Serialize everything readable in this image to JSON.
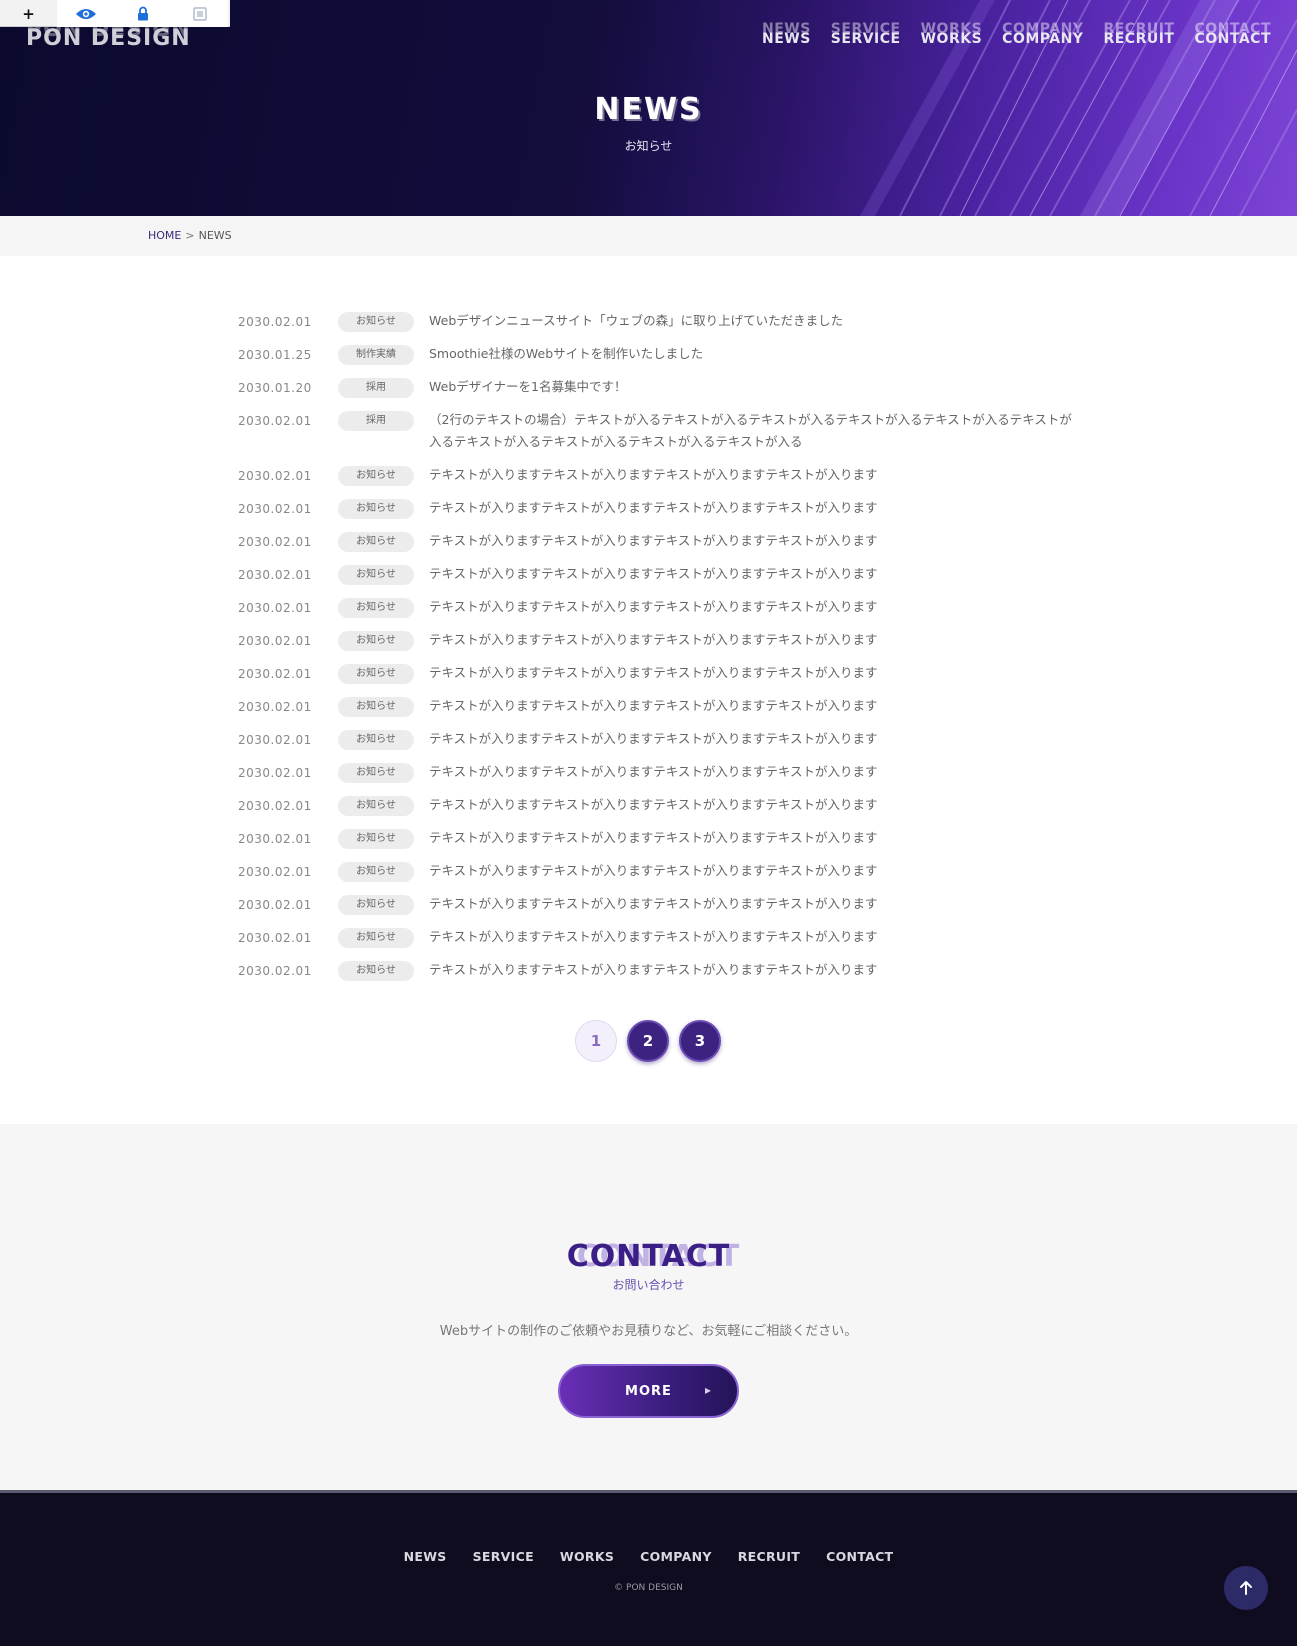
{
  "toolbar": {
    "add_label": "+",
    "icons": [
      "eye-icon",
      "lock-icon",
      "layout-icon"
    ]
  },
  "header": {
    "logo": "PON DESIGN",
    "nav": [
      "NEWS",
      "SERVICE",
      "WORKS",
      "COMPANY",
      "RECRUIT",
      "CONTACT"
    ],
    "title": "NEWS",
    "subtitle": "お知らせ"
  },
  "breadcrumb": {
    "home": "HOME",
    "separator": ">",
    "current": "NEWS"
  },
  "news": [
    {
      "date": "2030.02.01",
      "category": "お知らせ",
      "text": "Webデザインニュースサイト「ウェブの森」に取り上げていただきました"
    },
    {
      "date": "2030.01.25",
      "category": "制作実績",
      "text": "Smoothie社様のWebサイトを制作いたしました"
    },
    {
      "date": "2030.01.20",
      "category": "採用",
      "text": "Webデザイナーを1名募集中です！"
    },
    {
      "date": "2030.02.01",
      "category": "採用",
      "text": "（2行のテキストの場合）テキストが入るテキストが入るテキストが入るテキストが入るテキストが入るテキストが入るテキストが入るテキストが入るテキストが入るテキストが入る"
    },
    {
      "date": "2030.02.01",
      "category": "お知らせ",
      "text": "テキストが入りますテキストが入りますテキストが入りますテキストが入ります"
    },
    {
      "date": "2030.02.01",
      "category": "お知らせ",
      "text": "テキストが入りますテキストが入りますテキストが入りますテキストが入ります"
    },
    {
      "date": "2030.02.01",
      "category": "お知らせ",
      "text": "テキストが入りますテキストが入りますテキストが入りますテキストが入ります"
    },
    {
      "date": "2030.02.01",
      "category": "お知らせ",
      "text": "テキストが入りますテキストが入りますテキストが入りますテキストが入ります"
    },
    {
      "date": "2030.02.01",
      "category": "お知らせ",
      "text": "テキストが入りますテキストが入りますテキストが入りますテキストが入ります"
    },
    {
      "date": "2030.02.01",
      "category": "お知らせ",
      "text": "テキストが入りますテキストが入りますテキストが入りますテキストが入ります"
    },
    {
      "date": "2030.02.01",
      "category": "お知らせ",
      "text": "テキストが入りますテキストが入りますテキストが入りますテキストが入ります"
    },
    {
      "date": "2030.02.01",
      "category": "お知らせ",
      "text": "テキストが入りますテキストが入りますテキストが入りますテキストが入ります"
    },
    {
      "date": "2030.02.01",
      "category": "お知らせ",
      "text": "テキストが入りますテキストが入りますテキストが入りますテキストが入ります"
    },
    {
      "date": "2030.02.01",
      "category": "お知らせ",
      "text": "テキストが入りますテキストが入りますテキストが入りますテキストが入ります"
    },
    {
      "date": "2030.02.01",
      "category": "お知らせ",
      "text": "テキストが入りますテキストが入りますテキストが入りますテキストが入ります"
    },
    {
      "date": "2030.02.01",
      "category": "お知らせ",
      "text": "テキストが入りますテキストが入りますテキストが入りますテキストが入ります"
    },
    {
      "date": "2030.02.01",
      "category": "お知らせ",
      "text": "テキストが入りますテキストが入りますテキストが入りますテキストが入ります"
    },
    {
      "date": "2030.02.01",
      "category": "お知らせ",
      "text": "テキストが入りますテキストが入りますテキストが入りますテキストが入ります"
    },
    {
      "date": "2030.02.01",
      "category": "お知らせ",
      "text": "テキストが入りますテキストが入りますテキストが入りますテキストが入ります"
    },
    {
      "date": "2030.02.01",
      "category": "お知らせ",
      "text": "テキストが入りますテキストが入りますテキストが入りますテキストが入ります"
    }
  ],
  "pagination": {
    "pages": [
      "1",
      "2",
      "3"
    ],
    "current": "1"
  },
  "contact": {
    "title": "CONTACT",
    "subtitle": "お問い合わせ",
    "description": "Webサイトの制作のご依頼やお見積りなど、お気軽にご相談ください。",
    "button": "MORE"
  },
  "footer": {
    "nav": [
      "NEWS",
      "SERVICE",
      "WORKS",
      "COMPANY",
      "RECRUIT",
      "CONTACT"
    ],
    "copyright": "© PON DESIGN"
  },
  "colors": {
    "primary": "#3b1f86",
    "accent": "#6a2fb8",
    "footer_bg": "#0f0c1f",
    "contact_bg": "#f6f6f6"
  }
}
